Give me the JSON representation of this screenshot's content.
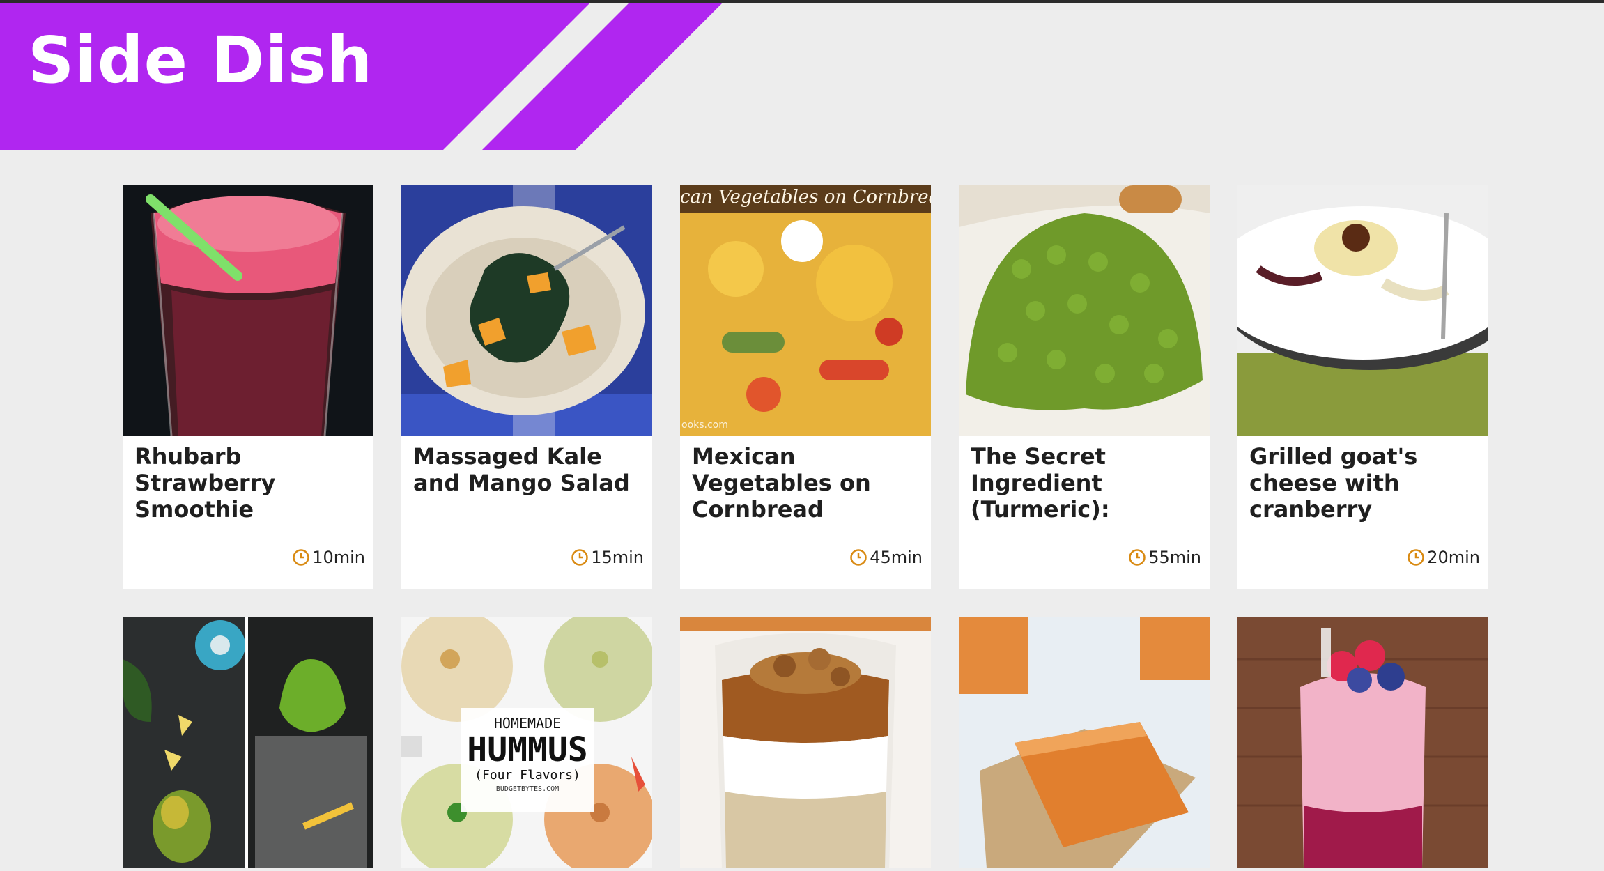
{
  "page": {
    "title": "Side Dish",
    "accent_color": "#b026f0"
  },
  "recipes": [
    {
      "title": "Rhubarb Strawberry Smoothie",
      "time": "10min"
    },
    {
      "title": "Massaged Kale and Mango Salad",
      "time": "15min"
    },
    {
      "title": "Mexican Vegetables on Cornbread",
      "time": "45min",
      "image_caption": "can Vegetables on Cornbread",
      "image_watermark": "ooks.com"
    },
    {
      "title": "The Secret Ingredient (Turmeric): Maman'...",
      "time": "55min"
    },
    {
      "title": "Grilled goat's cheese with cranberry dressing",
      "time": "20min"
    },
    {
      "title": "",
      "time": ""
    },
    {
      "title": "",
      "time": "",
      "image_text": {
        "line1": "HOMEMADE",
        "line2": "HUMMUS",
        "line3": "(Four Flavors)",
        "line4": "BUDGETBYTES.COM"
      }
    },
    {
      "title": "",
      "time": ""
    },
    {
      "title": "",
      "time": ""
    },
    {
      "title": "",
      "time": ""
    }
  ],
  "icons": {
    "time": "clock-icon"
  }
}
